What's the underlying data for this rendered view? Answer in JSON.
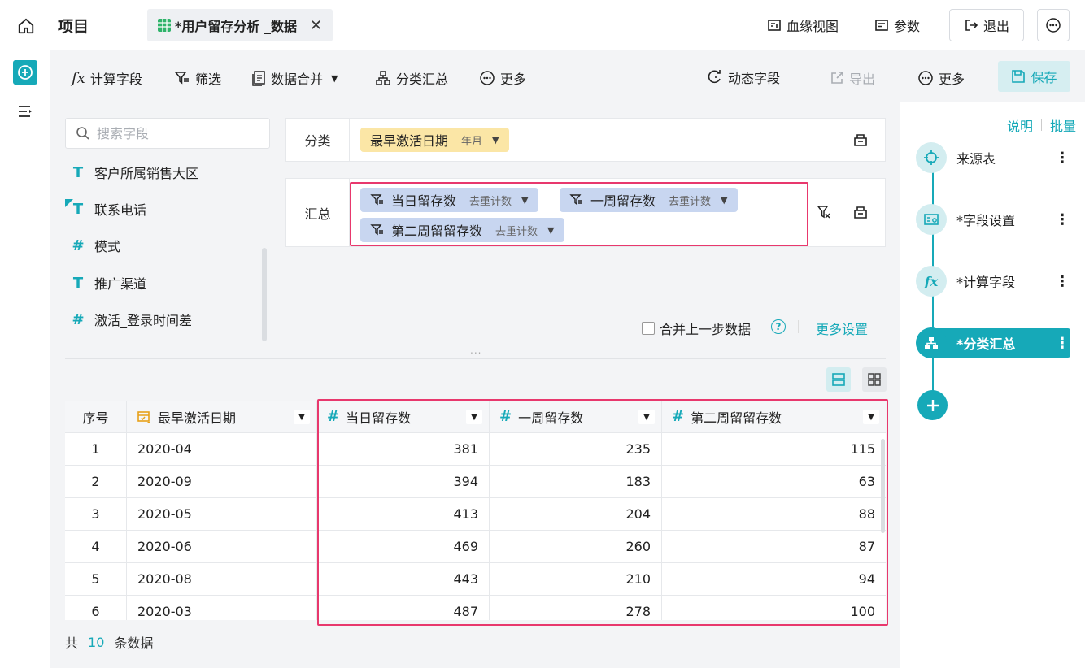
{
  "header": {
    "project_title": "项目",
    "tab_label": "*用户留存分析 _数据",
    "lineage_label": "血缘视图",
    "params_label": "参数",
    "exit_label": "退出"
  },
  "toolbar": {
    "calc_field": "计算字段",
    "filter": "筛选",
    "merge": "数据合并",
    "group_summary": "分类汇总",
    "more": "更多",
    "dynamic_field": "动态字段",
    "export": "导出"
  },
  "field_list": {
    "search_placeholder": "搜索字段",
    "items": [
      {
        "type": "T",
        "name": "客户所属销售大区"
      },
      {
        "type": "T",
        "name": "联系电话"
      },
      {
        "type": "#",
        "name": "模式"
      },
      {
        "type": "T",
        "name": "推广渠道"
      },
      {
        "type": "#",
        "name": "激活_登录时间差"
      }
    ]
  },
  "config": {
    "group_label": "分类",
    "group_field": "最早激活日期",
    "group_field_sub": "年月",
    "summary_label": "汇总",
    "summary_fields": [
      {
        "name": "当日留存数",
        "agg": "去重计数"
      },
      {
        "name": "一周留存数",
        "agg": "去重计数"
      },
      {
        "name": "第二周留留存数",
        "agg": "去重计数"
      }
    ],
    "merge_prev_label": "合并上一步数据",
    "help_glyph": "?",
    "more_settings": "更多设置",
    "drag_handle": "..."
  },
  "table": {
    "columns": [
      "序号",
      "最早激活日期",
      "当日留存数",
      "一周留存数",
      "第二周留留存数"
    ],
    "rows": [
      [
        "1",
        "2020-04",
        "381",
        "235",
        "115"
      ],
      [
        "2",
        "2020-09",
        "394",
        "183",
        "63"
      ],
      [
        "3",
        "2020-05",
        "413",
        "204",
        "88"
      ],
      [
        "4",
        "2020-06",
        "469",
        "260",
        "87"
      ],
      [
        "5",
        "2020-08",
        "443",
        "210",
        "94"
      ],
      [
        "6",
        "2020-03",
        "487",
        "278",
        "100"
      ]
    ]
  },
  "footer": {
    "prefix": "共",
    "count": "10",
    "suffix": "条数据"
  },
  "right_panel": {
    "more": "更多",
    "save": "保存",
    "explain": "说明",
    "batch": "批量",
    "steps": [
      {
        "label": "来源表",
        "icon": "source-target-icon"
      },
      {
        "label": "*字段设置",
        "icon": "field-settings-icon"
      },
      {
        "label": "*计算字段",
        "icon": "fx-icon"
      },
      {
        "label": "*分类汇总",
        "icon": "hierarchy-icon"
      }
    ]
  },
  "colors": {
    "accent": "#16a9b8",
    "highlight": "#e8386d",
    "chip_yellow": "#fbe6a6",
    "chip_blue": "#c8d6f0"
  }
}
